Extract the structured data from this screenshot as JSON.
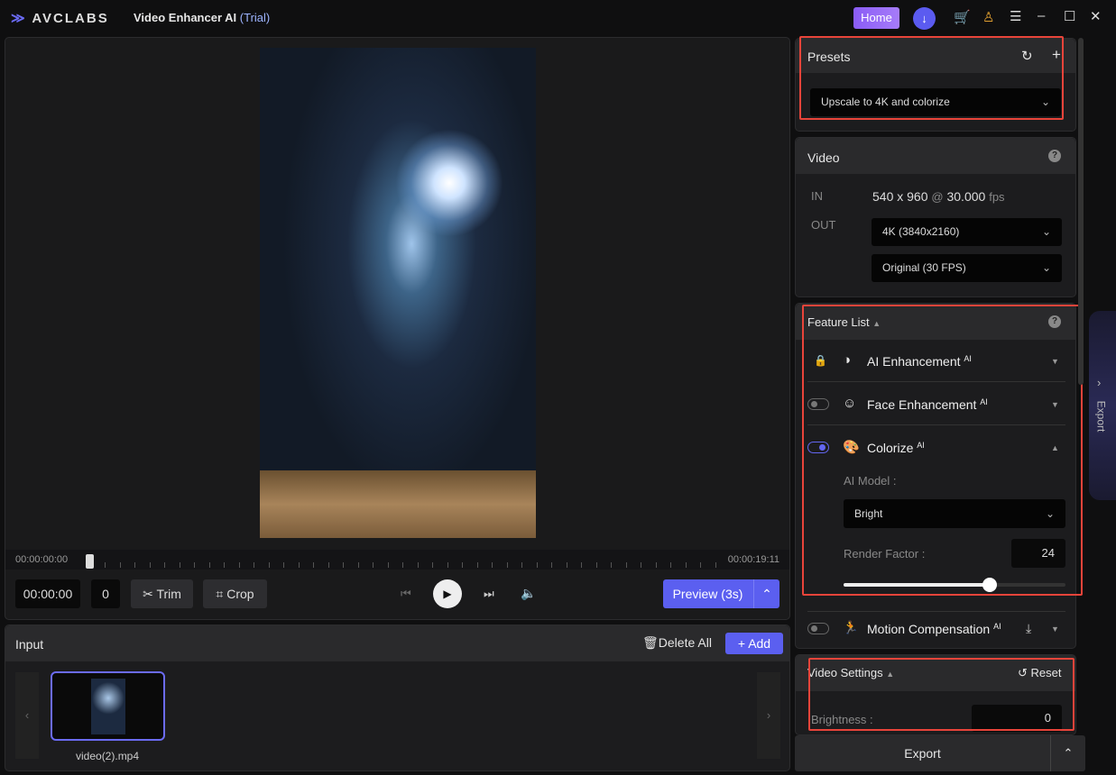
{
  "app": {
    "brand": "AVCLABS",
    "title": "Video Enhancer AI",
    "trial": "(Trial)",
    "home": "Home"
  },
  "player": {
    "start_time": "00:00:00:00",
    "end_time": "00:00:19:11",
    "time": "00:00:00",
    "frame": "0",
    "trim": "Trim",
    "crop": "Crop",
    "preview": "Preview (3s)"
  },
  "input": {
    "title": "Input",
    "delete_all": "Delete All",
    "add": "Add",
    "files": [
      {
        "name": "video(2).mp4"
      }
    ]
  },
  "presets": {
    "title": "Presets",
    "selected": "Upscale to 4K and colorize"
  },
  "video": {
    "title": "Video",
    "in_label": "IN",
    "in_res": "540 x 960",
    "at": "@",
    "in_fps": "30.000",
    "fps": "fps",
    "out_label": "OUT",
    "resolution": "4K (3840x2160)",
    "framerate": "Original (30 FPS)"
  },
  "features": {
    "title": "Feature List",
    "items": [
      {
        "label": "AI Enhancement",
        "badge": "AI"
      },
      {
        "label": "Face Enhancement",
        "badge": "AI"
      },
      {
        "label": "Colorize",
        "badge": "AI"
      },
      {
        "label": "Motion Compensation",
        "badge": "AI"
      }
    ],
    "colorize": {
      "model_label": "AI Model :",
      "model": "Bright",
      "render_label": "Render Factor :",
      "render_value": "24",
      "slider_fraction": 0.66
    }
  },
  "video_settings": {
    "title": "Video Settings",
    "reset": "Reset",
    "brightness_label": "Brightness :",
    "brightness": "0"
  },
  "export": {
    "label": "Export",
    "side_tab": "Export"
  },
  "colors": {
    "accent": "#5b5ff0",
    "highlight": "#e8443a"
  }
}
